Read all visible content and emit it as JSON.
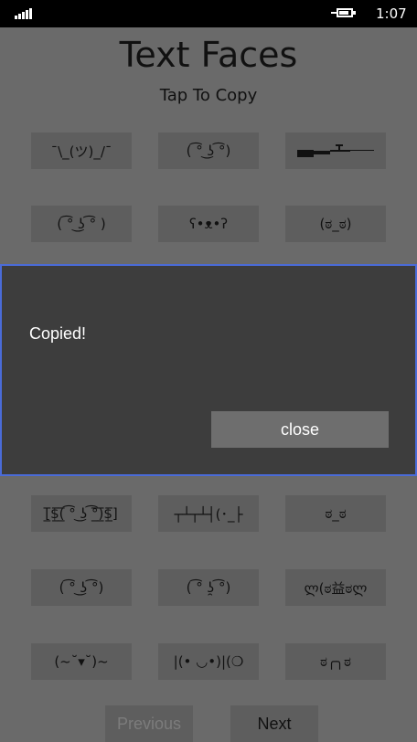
{
  "status": {
    "time": "1:07"
  },
  "header": {
    "title": "Text Faces",
    "subtitle": "Tap To Copy"
  },
  "faces": [
    "¯\\_(ツ)_/¯",
    "( ͡° ͜ʖ ͡°)",
    "",
    "( ͡° ͜ʖ ͡° )",
    "ʕ•ᴥ•ʔ",
    "(ಠ_ಠ)",
    "[̲̅$̲̅(̲̅ ͡° ͜ʖ ͡°̲̅)̲̅$̲̅]",
    "┬┴┬┴┤(･_├",
    "ಠ_ಠ",
    "( ͡° ʖ̯ ͡°)",
    "( ͡° ͜ʖ ͡°)",
    "ლ(ಠ益ಠლ",
    "(~˘▾˘)~",
    "|(• ◡•)|(❍",
    "ಠ╭╮ಠ"
  ],
  "dialog": {
    "message": "Copied!",
    "close_label": "close"
  },
  "nav": {
    "previous_label": "Previous",
    "next_label": "Next"
  },
  "colors": {
    "background": "#6a6a6a",
    "tile": "#5e5e5e",
    "dialog": "#3d3d3d",
    "dialog_border": "#4a6bd8"
  }
}
